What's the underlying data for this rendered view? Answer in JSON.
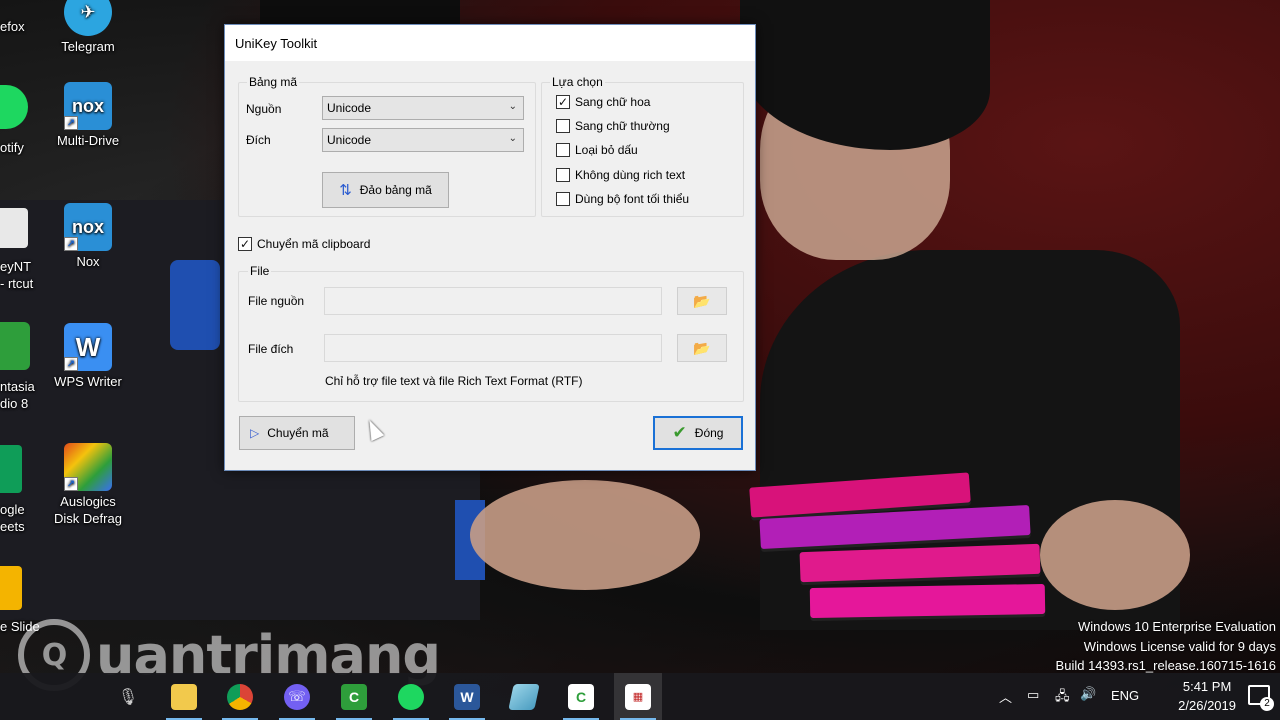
{
  "desktop": {
    "icons": [
      {
        "label": "Telegram",
        "icon": "telegram-icon",
        "color": "#2ca5e0"
      },
      {
        "label": "Multi-Drive",
        "icon": "nox-icon",
        "color": "#2a8fd6"
      },
      {
        "label": "Nox",
        "icon": "nox-icon",
        "color": "#2a8fd6"
      },
      {
        "label": "WPS Writer",
        "icon": "wps-writer-icon",
        "color": "#3a8ff2"
      },
      {
        "label": "Auslogics Disk Defrag",
        "icon": "auslogics-icon",
        "color": "#e04a1a"
      }
    ],
    "edge_icons": [
      {
        "label": "efox",
        "icon": "firefox-icon",
        "color": "#e66000"
      },
      {
        "label": "otify",
        "icon": "spotify-icon",
        "color": "#1ed760"
      },
      {
        "label": "eyNT - rtcut",
        "icon": "keynt-icon",
        "color": "#d8d8d8"
      },
      {
        "label": "ntasia dio 8",
        "icon": "camtasia-icon",
        "color": "#2e9e3b"
      },
      {
        "label": "ogle eets",
        "icon": "google-sheets-icon",
        "color": "#0f9d58"
      },
      {
        "label": "e Slides",
        "icon": "google-slides-icon",
        "color": "#f4b400"
      }
    ]
  },
  "dialog": {
    "title": "UniKey Toolkit",
    "charset_group": {
      "title": "Bảng mã",
      "source_label": "Nguồn",
      "source_value": "Unicode",
      "target_label": "Đích",
      "target_value": "Unicode",
      "swap_button": "Đảo bảng mã"
    },
    "options_group": {
      "title": "Lựa chọn",
      "options": [
        {
          "label": "Sang chữ hoa",
          "checked": true
        },
        {
          "label": "Sang chữ thường",
          "checked": false
        },
        {
          "label": "Loại bỏ dấu",
          "checked": false
        },
        {
          "label": "Không dùng rich text",
          "checked": false
        },
        {
          "label": "Dùng bộ font tối thiểu",
          "checked": false
        }
      ]
    },
    "clipboard": {
      "label": "Chuyển mã clipboard",
      "checked": true
    },
    "file_group": {
      "title": "File",
      "source_label": "File nguồn",
      "target_label": "File đích",
      "note": "Chỉ hỗ trợ file text và file Rich Text Format (RTF)"
    },
    "convert_button": "Chuyển mã",
    "close_button": "Đóng"
  },
  "watermark": {
    "text": "uantrimang",
    "letter": "Q"
  },
  "license": {
    "line1": "Windows 10 Enterprise Evaluation",
    "line2": "Windows License valid for 9 days",
    "line3": "Build 14393.rs1_release.160715-1616"
  },
  "taskbar": {
    "language": "ENG",
    "time": "5:41 PM",
    "date": "2/26/2019",
    "notifications": "2",
    "apps": [
      "file-explorer-icon",
      "chrome-icon",
      "viber-icon",
      "camtasia-icon",
      "spotify-icon",
      "word-icon",
      "app-icon",
      "camtasia-recorder-icon",
      "unikey-icon"
    ]
  },
  "colors": {
    "accent": "#1a71d6",
    "check": "#3a9a2e"
  }
}
